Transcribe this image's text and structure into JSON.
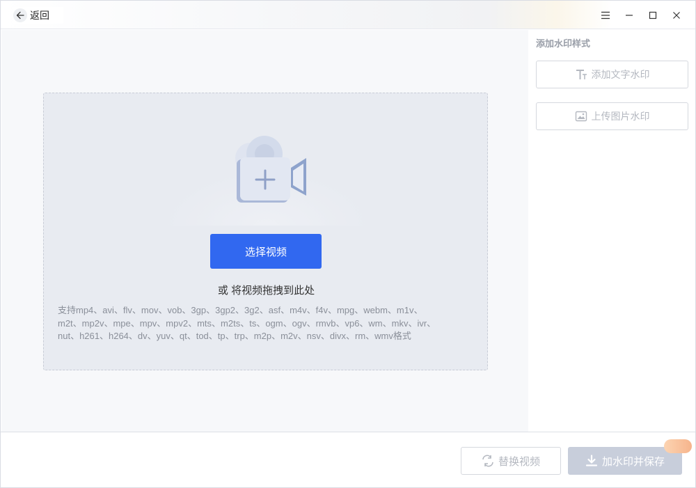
{
  "titlebar": {
    "back_label": "返回",
    "controls": [
      "menu-icon",
      "minimize-icon",
      "maximize-icon",
      "close-icon"
    ]
  },
  "upload": {
    "select_button": "选择视频",
    "drag_hint": "或 将视频拖拽到此处",
    "formats_line1": "支持mp4、avi、flv、mov、vob、3gp、3gp2、3g2、asf、m4v、f4v、mpg、webm、m1v、",
    "formats_line2": "m2t、mp2v、mpe、mpv、mpv2、mts、m2ts、ts、ogm、ogv、rmvb、vp6、wm、mkv、ivr、",
    "formats_line3": "nut、h261、h264、dv、yuv、qt、tod、tp、trp、m2p、m2v、nsv、divx、rm、wmv格式"
  },
  "panel": {
    "title": "添加水印样式",
    "text_watermark": "添加文字水印",
    "image_watermark": "上传图片水印"
  },
  "bottom": {
    "replace_video": "替换视频",
    "save": "加水印并保存"
  },
  "colors": {
    "primary": "#3168f0",
    "disabled_save": "#c8cedb",
    "dropzone_bg": "#e8ebf1"
  }
}
